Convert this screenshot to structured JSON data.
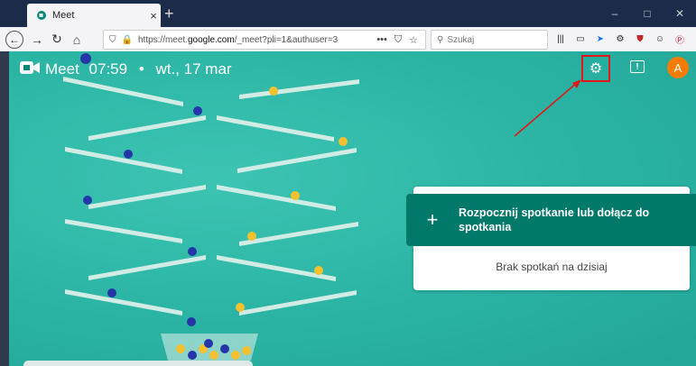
{
  "browser": {
    "tab_title": "Meet",
    "url_prefix": "https://meet.",
    "url_domain": "google.com",
    "url_path": "/_meet?pli=1&authuser=3",
    "search_placeholder": "Szukaj"
  },
  "meet": {
    "app_name": "Meet",
    "time": "07:59",
    "separator": "•",
    "date": "wt., 17 mar",
    "avatar_letter": "A",
    "start_meeting_label": "Rozpocznij spotkanie lub dołącz do spotkania",
    "no_meetings": "Brak spotkań na dzisiaj"
  },
  "colors": {
    "accent": "#00796b",
    "background": "#2ab3a3",
    "annotation": "#e01818",
    "avatar": "#f57c00"
  },
  "icons": {
    "settings": "gear-icon",
    "feedback": "feedback-icon",
    "add": "plus-icon"
  }
}
